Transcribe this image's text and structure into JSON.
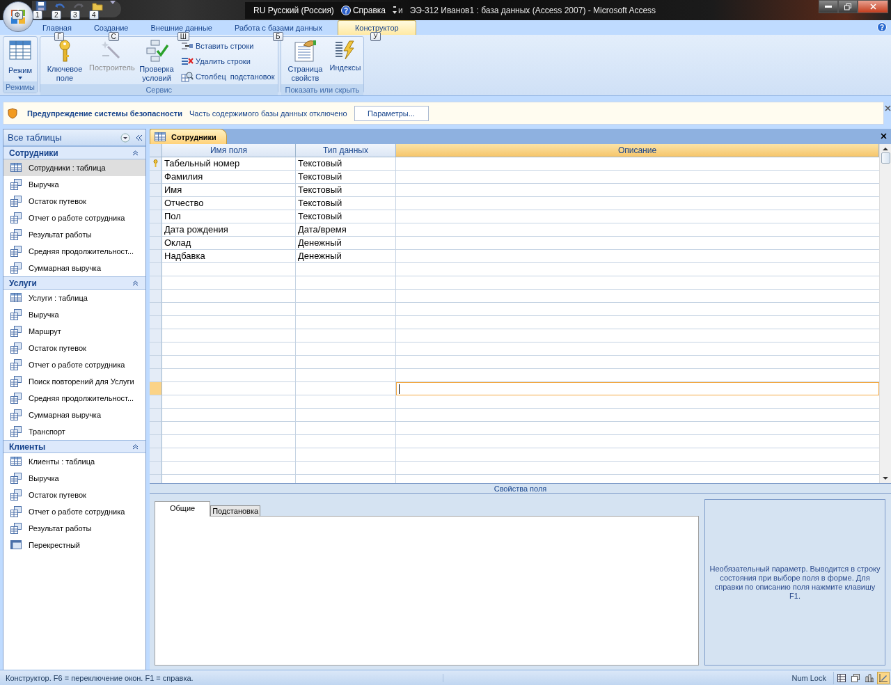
{
  "title_bar": {
    "office_key_tip": "Ф",
    "quick_access": [
      {
        "kind": "save",
        "key_tip": "1",
        "disabled": false
      },
      {
        "kind": "undo",
        "key_tip": "2",
        "disabled": false
      },
      {
        "kind": "redo",
        "key_tip": "3",
        "disabled": true
      },
      {
        "kind": "folder",
        "key_tip": "4",
        "disabled": false
      }
    ],
    "language_bar": {
      "language": "RU Русский (Россия)",
      "help": "Справка",
      "partial": "и"
    },
    "title": "ЭЭ-312 Иванов1 : база данных (Access 2007)  - Microsoft Access"
  },
  "ribbon": {
    "tabs": [
      {
        "label": "Главная",
        "key_tip": "Г",
        "selected": false
      },
      {
        "label": "Создание",
        "key_tip": "С",
        "selected": false
      },
      {
        "label": "Внешние данные",
        "key_tip": "Ш",
        "selected": false
      },
      {
        "label": "Работа с базами данных",
        "key_tip": "Б",
        "selected": false
      },
      {
        "label": "Конструктор",
        "key_tip": "У",
        "selected": true
      }
    ],
    "groups": [
      {
        "label": "Режимы",
        "buttons": [
          {
            "kind": "large",
            "label": "Режим",
            "dropdown": true,
            "disabled": false
          }
        ]
      },
      {
        "label": "Сервис",
        "buttons": [
          {
            "kind": "large",
            "label": "Ключевое поле",
            "dropdown": false,
            "disabled": false
          },
          {
            "kind": "large",
            "label": "Построитель",
            "dropdown": false,
            "disabled": true
          },
          {
            "kind": "large",
            "label": "Проверка условий",
            "dropdown": false,
            "disabled": false
          },
          {
            "kind": "small",
            "label": "Вставить строки",
            "disabled": false
          },
          {
            "kind": "small",
            "label": "Удалить строки",
            "disabled": false
          },
          {
            "kind": "small",
            "label": "Столбец  подстановок",
            "disabled": false
          }
        ]
      },
      {
        "label": "Показать или скрыть",
        "buttons": [
          {
            "kind": "large",
            "label": "Страница свойств",
            "dropdown": false,
            "disabled": false
          },
          {
            "kind": "large",
            "label": "Индексы",
            "dropdown": false,
            "disabled": false
          }
        ]
      }
    ]
  },
  "security_bar": {
    "title": "Предупреждение системы безопасности",
    "message": "Часть содержимого базы данных отключено",
    "button": "Параметры..."
  },
  "navigation": {
    "header": "Все таблицы",
    "groups": [
      {
        "title": "Сотрудники",
        "expanded": true,
        "items": [
          {
            "kind": "table",
            "label": "Сотрудники : таблица",
            "selected": true
          },
          {
            "kind": "query",
            "label": "Выручка",
            "selected": false
          },
          {
            "kind": "query",
            "label": "Остаток путевок",
            "selected": false
          },
          {
            "kind": "query",
            "label": "Отчет о работе сотрудника",
            "selected": false
          },
          {
            "kind": "query",
            "label": "Результат работы",
            "selected": false
          },
          {
            "kind": "query",
            "label": "Средняя продолжительност...",
            "selected": false
          },
          {
            "kind": "query",
            "label": "Суммарная выручка",
            "selected": false
          }
        ]
      },
      {
        "title": "Услуги",
        "expanded": true,
        "items": [
          {
            "kind": "table",
            "label": "Услуги : таблица",
            "selected": false
          },
          {
            "kind": "query",
            "label": "Выручка",
            "selected": false
          },
          {
            "kind": "query",
            "label": "Маршрут",
            "selected": false
          },
          {
            "kind": "query",
            "label": "Остаток путевок",
            "selected": false
          },
          {
            "kind": "query",
            "label": "Отчет о работе сотрудника",
            "selected": false
          },
          {
            "kind": "query",
            "label": "Поиск повторений для Услуги",
            "selected": false
          },
          {
            "kind": "query",
            "label": "Средняя продолжительност...",
            "selected": false
          },
          {
            "kind": "query",
            "label": "Суммарная выручка",
            "selected": false
          },
          {
            "kind": "query",
            "label": "Транспорт",
            "selected": false
          }
        ]
      },
      {
        "title": "Клиенты",
        "expanded": true,
        "items": [
          {
            "kind": "table",
            "label": "Клиенты : таблица",
            "selected": false
          },
          {
            "kind": "query",
            "label": "Выручка",
            "selected": false
          },
          {
            "kind": "query",
            "label": "Остаток путевок",
            "selected": false
          },
          {
            "kind": "query",
            "label": "Отчет о работе сотрудника",
            "selected": false
          },
          {
            "kind": "query",
            "label": "Результат работы",
            "selected": false
          },
          {
            "kind": "crosstab",
            "label": "Перекрестный",
            "selected": false
          }
        ]
      }
    ]
  },
  "document": {
    "tab": "Сотрудники",
    "columns": [
      {
        "label": "Имя поля",
        "selected": false
      },
      {
        "label": "Тип данных",
        "selected": false
      },
      {
        "label": "Описание",
        "selected": true
      }
    ],
    "rows": [
      {
        "name": "Табельный номер",
        "type": "Текстовый",
        "key": true,
        "selected": false
      },
      {
        "name": "Фамилия",
        "type": "Текстовый",
        "key": false,
        "selected": false
      },
      {
        "name": "Имя",
        "type": "Текстовый",
        "key": false,
        "selected": false
      },
      {
        "name": "Отчество",
        "type": "Текстовый",
        "key": false,
        "selected": false
      },
      {
        "name": "Пол",
        "type": "Текстовый",
        "key": false,
        "selected": false
      },
      {
        "name": "Дата рождения",
        "type": "Дата/время",
        "key": false,
        "selected": false
      },
      {
        "name": "Оклад",
        "type": "Денежный",
        "key": false,
        "selected": false
      },
      {
        "name": "Надбавка",
        "type": "Денежный",
        "key": false,
        "selected": false
      },
      {
        "key": false,
        "selected": false
      },
      {
        "key": false,
        "selected": false
      },
      {
        "key": false,
        "selected": false
      },
      {
        "key": false,
        "selected": false
      },
      {
        "key": false,
        "selected": false
      },
      {
        "key": false,
        "selected": false
      },
      {
        "key": false,
        "selected": false
      },
      {
        "key": false,
        "selected": false
      },
      {
        "key": false,
        "selected": false
      },
      {
        "key": false,
        "selected": true
      },
      {
        "key": false,
        "selected": false
      },
      {
        "key": false,
        "selected": false
      },
      {
        "key": false,
        "selected": false
      },
      {
        "key": false,
        "selected": false
      },
      {
        "key": false,
        "selected": false
      },
      {
        "key": false,
        "selected": false
      },
      {
        "key": false,
        "selected": false
      }
    ],
    "properties": {
      "title": "Свойства поля",
      "tabs": [
        {
          "label": "Общие",
          "selected": true
        },
        {
          "label": "Подстановка",
          "selected": false
        }
      ],
      "help": "Необязательный параметр.  Выводится в строку состояния при выборе поля в форме. Для справки по описанию поля нажмите клавишу F1."
    }
  },
  "status_bar": {
    "text": "Конструктор.  F6 = переключение окон.  F1 = справка.",
    "indicator": "Num Lock",
    "views": [
      {
        "kind": "datasheet",
        "selected": false
      },
      {
        "kind": "pivot-table",
        "selected": false
      },
      {
        "kind": "pivot-chart",
        "selected": false
      },
      {
        "kind": "design",
        "selected": true
      }
    ]
  }
}
